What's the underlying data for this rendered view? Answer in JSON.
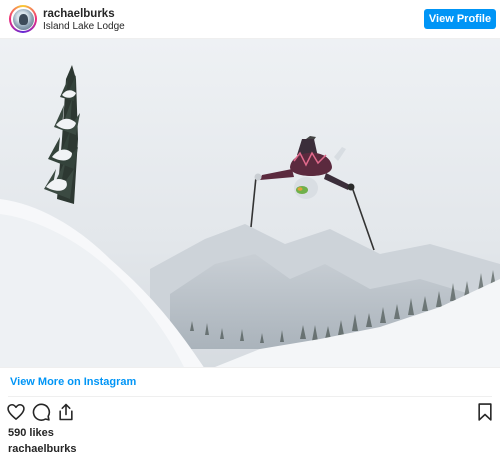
{
  "header": {
    "username": "rachaelburks",
    "location": "Island Lake Lodge",
    "view_profile_label": "View Profile"
  },
  "post": {
    "view_more_label": "View More on Instagram",
    "likes_text": "590 likes",
    "caption_username": "rachaelburks"
  },
  "icons": {
    "like": "heart-icon",
    "comment": "comment-icon",
    "share": "share-icon",
    "save": "bookmark-icon"
  },
  "colors": {
    "accent": "#0095f6",
    "text": "#262626"
  }
}
